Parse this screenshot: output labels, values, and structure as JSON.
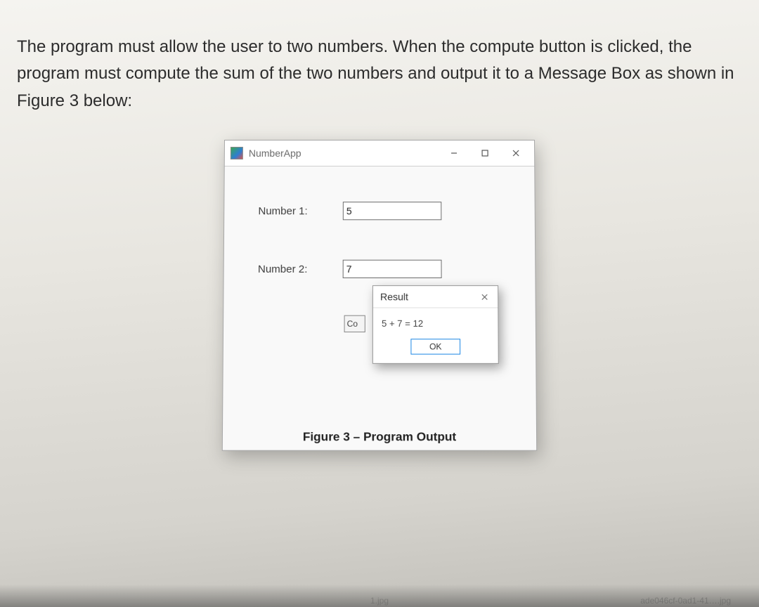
{
  "instruction": "The program must allow the user to two numbers. When the compute button is clicked, the program must compute the sum of the two numbers and output it to a Message Box as shown in Figure 3 below:",
  "app": {
    "title": "NumberApp",
    "number1_label": "Number 1:",
    "number1_value": "5",
    "number2_label": "Number 2:",
    "number2_value": "7",
    "compute_label": "Co"
  },
  "msgbox": {
    "title": "Result",
    "body": "5 + 7 = 12",
    "ok": "OK"
  },
  "caption": "Figure 3 – Program Output",
  "hints": {
    "filename": "1.jpg",
    "corner": "ade046cf-0ad1-41….jpg"
  }
}
